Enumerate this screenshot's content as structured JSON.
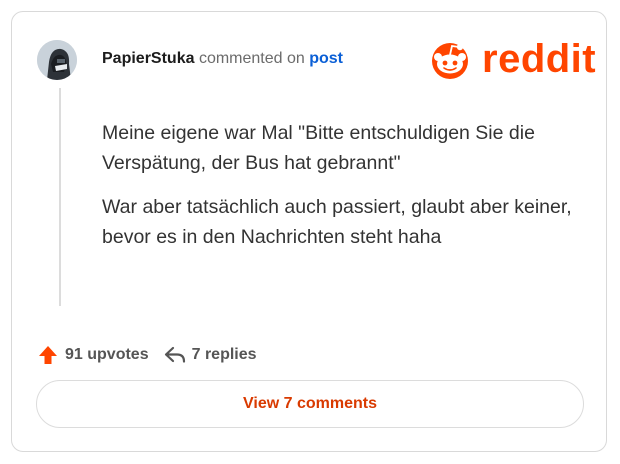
{
  "comment": {
    "username": "PapierStuka",
    "action_text": "commented on",
    "post_link": "post",
    "paragraphs": [
      "Meine eigene war Mal \"Bitte entschuldigen Sie die Verspätung, der Bus hat gebrannt\"",
      "War aber tatsächlich auch passiert, glaubt aber keiner, bevor es in den Nachrichten steht haha"
    ]
  },
  "brand": {
    "logo_text": "reddit",
    "color": "#ff4500"
  },
  "stats": {
    "upvotes": "91 upvotes",
    "replies": "7 replies"
  },
  "button": {
    "label": "View 7 comments"
  },
  "colors": {
    "accent": "#ff4500",
    "button_text": "#d93a00",
    "link": "#0a5fd6"
  }
}
